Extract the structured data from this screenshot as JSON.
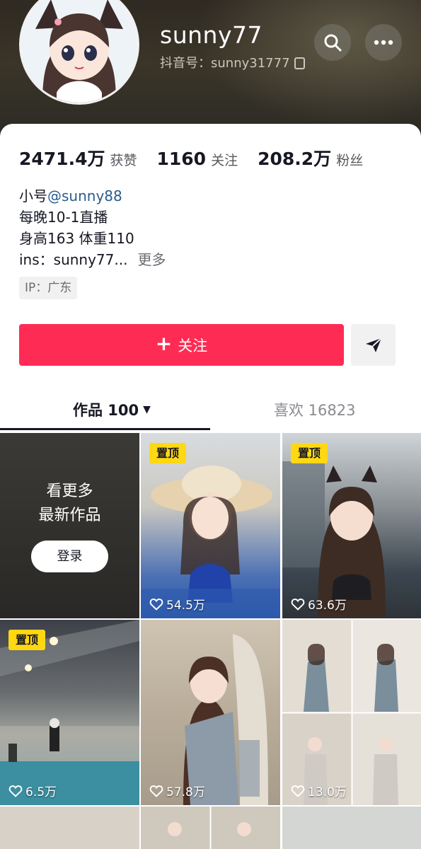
{
  "profile": {
    "username": "sunny77",
    "douyin_id": "抖音号：sunny31777",
    "stats": [
      {
        "value": "2471.4万",
        "label": "获赞"
      },
      {
        "value": "1160",
        "label": "关注"
      },
      {
        "value": "208.2万",
        "label": "粉丝"
      }
    ],
    "bio": {
      "line1_prefix": "小号",
      "line1_link": "@sunny88",
      "line2": "每晚10-1直播",
      "line3": "身高163 体重110",
      "line4": "ins：sunny77...",
      "more": "更多"
    },
    "ip": "IP：广东",
    "follow_label": "关注",
    "follow_plus": "+"
  },
  "tabs": {
    "works": "作品 100",
    "works_caret": "▼",
    "likes": "喜欢 16823"
  },
  "grid": {
    "login_text_1": "看更多",
    "login_text_2": "最新作品",
    "login_button": "登录",
    "pin_label": "置顶",
    "items": [
      {
        "pinned": true,
        "likes": "54.5万"
      },
      {
        "pinned": true,
        "likes": "63.6万"
      },
      {
        "pinned": true,
        "likes": "6.5万"
      },
      {
        "pinned": false,
        "likes": "57.8万"
      },
      {
        "pinned": false,
        "likes": "13.0万"
      }
    ]
  },
  "icons": {
    "search": "search-icon",
    "more": "more-icon",
    "send": "send-icon",
    "heart": "heart-icon",
    "copy": "copy-icon"
  },
  "colors": {
    "accent": "#fe2c55",
    "pin": "#fed813",
    "link": "#2a5d8f"
  }
}
